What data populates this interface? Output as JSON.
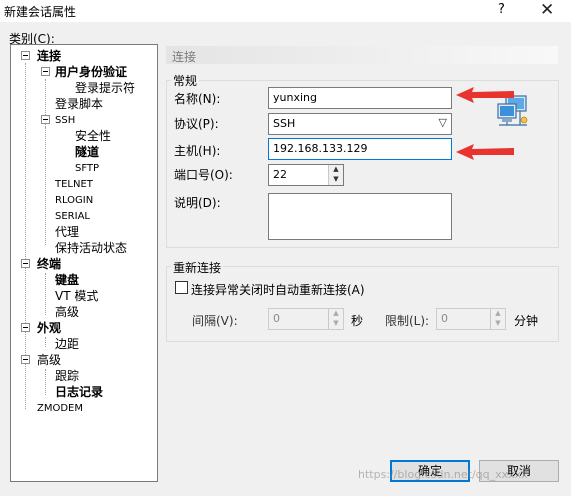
{
  "window": {
    "title": "新建会话属性",
    "help": "?",
    "close": "✕"
  },
  "category_label": "类别(C):",
  "tree": {
    "connection": "连接",
    "auth": "用户身份验证",
    "login_prompt": "登录提示符",
    "login_script": "登录脚本",
    "ssh": "SSH",
    "security": "安全性",
    "tunnel": "隧道",
    "sftp": "SFTP",
    "telnet": "TELNET",
    "rlogin": "RLOGIN",
    "serial": "SERIAL",
    "proxy": "代理",
    "keepalive": "保持活动状态",
    "terminal": "终端",
    "keyboard": "键盘",
    "vt_mode": "VT 模式",
    "advanced": "高级",
    "appearance": "外观",
    "margin": "边距",
    "advanced2": "高级",
    "trace": "跟踪",
    "log": "日志记录",
    "zmodem": "ZMODEM"
  },
  "section_header": "连接",
  "general": {
    "title": "常规",
    "name_label": "名称(N):",
    "name_value": "yunxing",
    "protocol_label": "协议(P):",
    "protocol_value": "SSH",
    "host_label": "主机(H):",
    "host_value": "192.168.133.129",
    "port_label": "端口号(O):",
    "port_value": "22",
    "desc_label": "说明(D):",
    "desc_value": ""
  },
  "reconnect": {
    "title": "重新连接",
    "checkbox_label": "连接异常关闭时自动重新连接(A)",
    "interval_label": "间隔(V):",
    "interval_value": "0",
    "interval_unit": "秒",
    "limit_label": "限制(L):",
    "limit_value": "0",
    "limit_unit": "分钟"
  },
  "buttons": {
    "ok": "确定",
    "cancel": "取消"
  },
  "watermark": "https://blog.csdn.net/qq_xxxxx",
  "colors": {
    "arrow": "#e8332e",
    "focus_border": "#0078d7"
  }
}
